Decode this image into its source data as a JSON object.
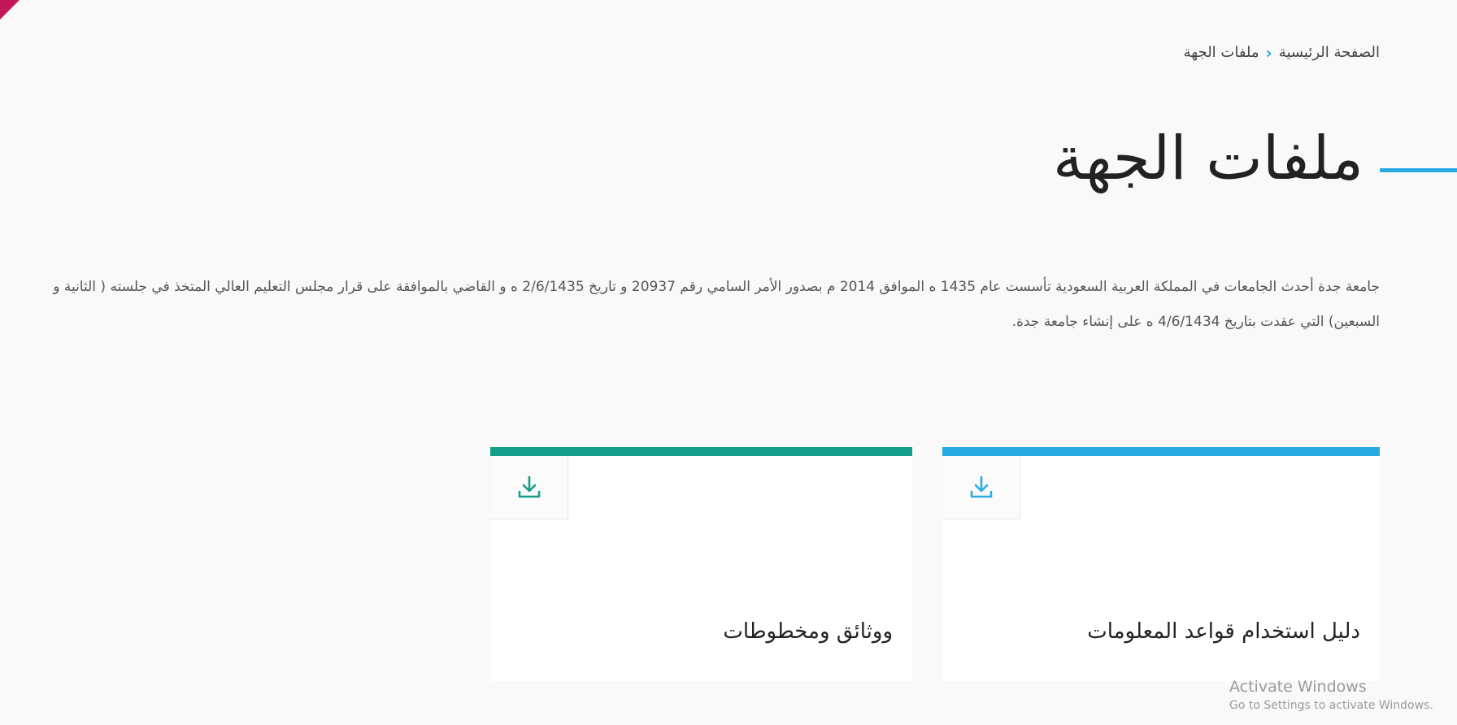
{
  "breadcrumb": {
    "home": "الصفحة الرئيسية",
    "separator": "‹",
    "current": "ملفات الجهة"
  },
  "page_title": "ملفات الجهة",
  "intro": "جامعة جدة أحدث الجامعات في المملكة العربية السعودية تأسست عام 1435 ه الموافق 2014 م بصدور الأمر السامي رقم 20937 و تاريخ 2/6/1435 ه و القاضي بالموافقة على قرار مجلس التعليم العالي المتخذ في جلسته ( الثانية و السبعين) التي عقدت بتاريخ 4/6/1434 ه على إنشاء جامعة جدة.",
  "cards": [
    {
      "title": "دليل استخدام قواعد المعلومات",
      "accent": "#29abe2",
      "icon": "download-icon"
    },
    {
      "title": "ووثائق ومخطوطات",
      "accent": "#139e8a",
      "icon": "download-icon"
    }
  ],
  "watermark": {
    "line1": "Activate Windows",
    "line2": "Go to Settings to activate Windows."
  },
  "colors": {
    "primary_blue": "#29abe2",
    "teal": "#139e8a",
    "corner": "#c2185b",
    "background": "#f9f9f9"
  }
}
